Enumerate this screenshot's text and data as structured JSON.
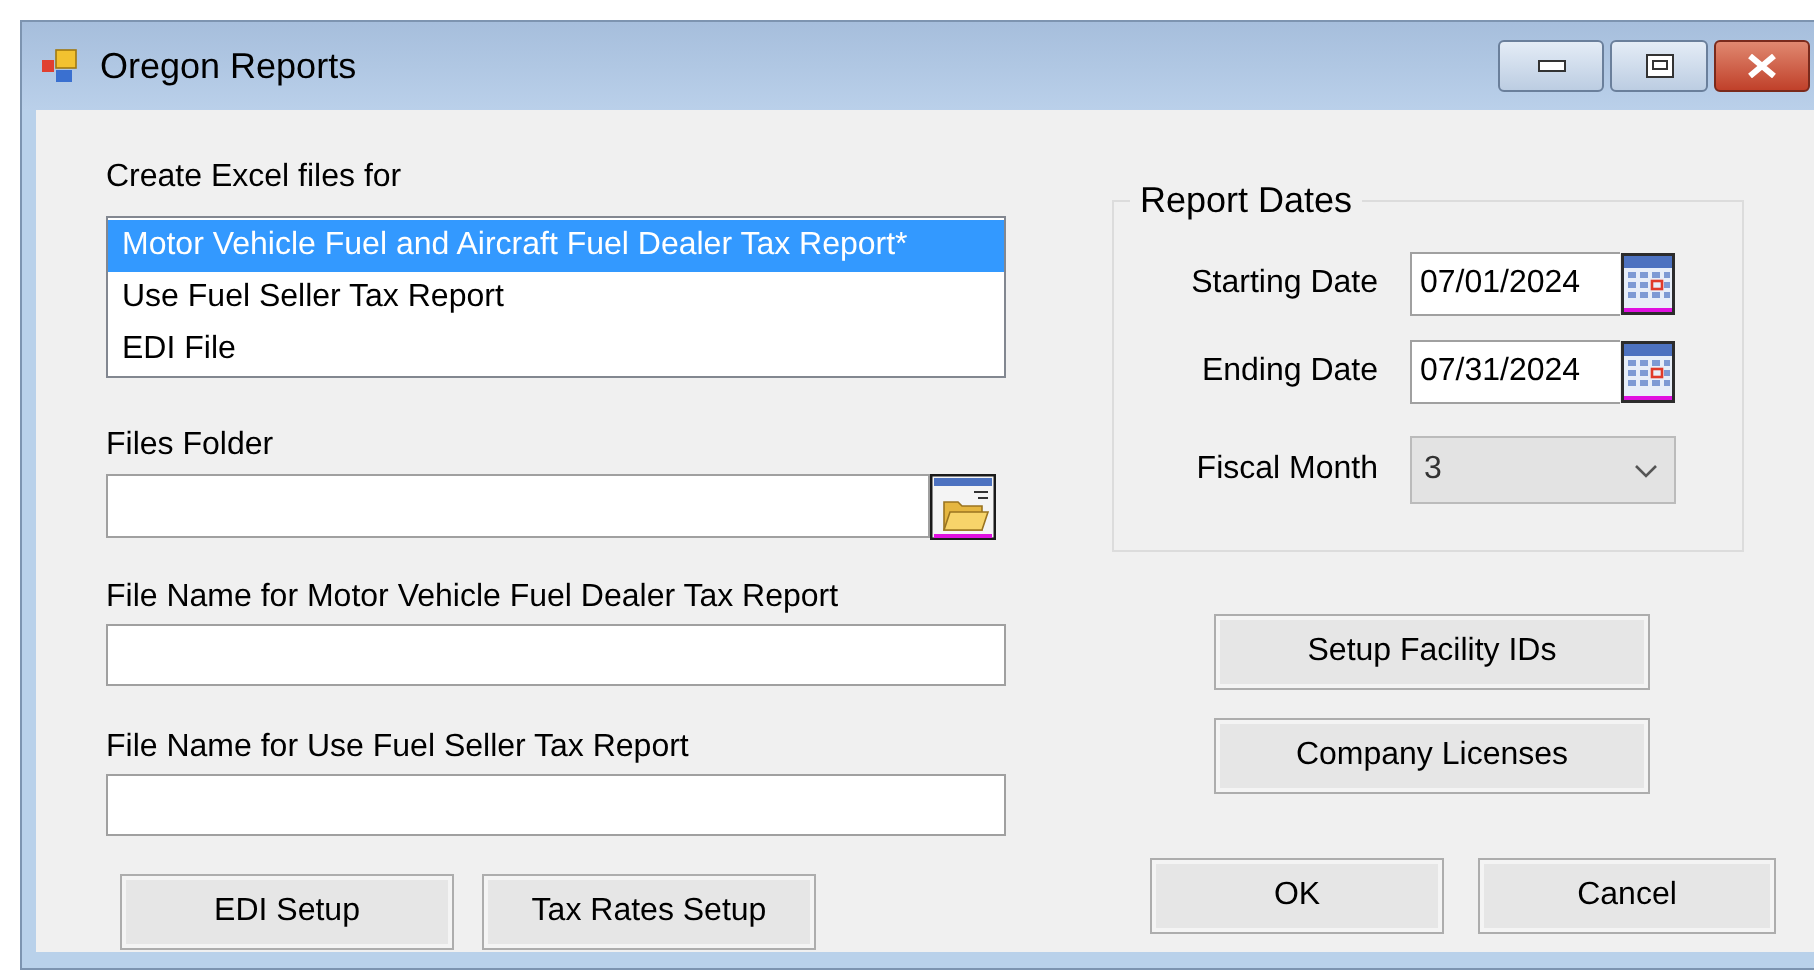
{
  "window": {
    "title": "Oregon Reports"
  },
  "create_excel_files": {
    "label": "Create Excel files for",
    "items": [
      {
        "label": "Motor Vehicle Fuel and Aircraft Fuel Dealer Tax Report*",
        "selected": true
      },
      {
        "label": "Use Fuel Seller Tax Report",
        "selected": false
      },
      {
        "label": "EDI File",
        "selected": false
      }
    ]
  },
  "files_folder": {
    "label": "Files Folder"
  },
  "motor_vehicle_file_name": {
    "label": "File Name for Motor Vehicle Fuel Dealer Tax Report"
  },
  "use_fuel_file_name": {
    "label": "File Name for Use Fuel Seller Tax Report"
  },
  "left_buttons": [
    "EDI Setup",
    "Tax Rates Setup"
  ],
  "report_dates": {
    "title": "Report Dates",
    "starting_date": {
      "label": "Starting Date",
      "value": "07/01/2024"
    },
    "ending_date": {
      "label": "Ending Date",
      "value": "07/31/2024"
    },
    "fiscal_month": {
      "label": "Fiscal Month",
      "value": "3",
      "disabled": true
    }
  },
  "setup_buttons": [
    "Setup Facility IDs",
    "Company Licenses"
  ],
  "dialog_buttons": [
    "OK",
    "Cancel"
  ]
}
